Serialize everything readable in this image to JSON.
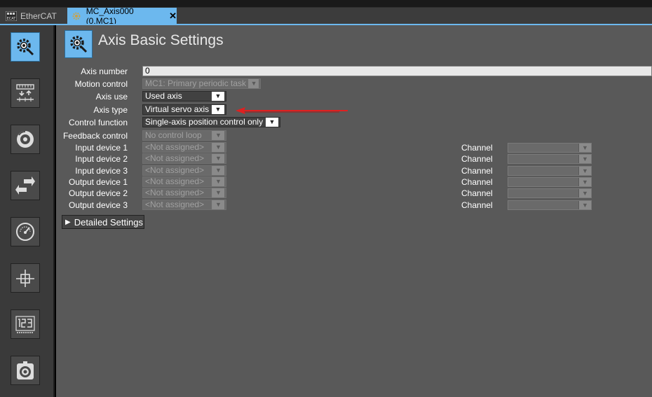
{
  "tabs": [
    {
      "label": "EtherCAT",
      "icon": "ethercat-icon"
    },
    {
      "label": "MC_Axis000 (0,MC1)",
      "icon": "axis-gear-icon",
      "close": "✕"
    }
  ],
  "sidebar": {
    "items": [
      {
        "name": "axis-basic-settings",
        "icon": "gear-settings-icon",
        "active": true
      },
      {
        "name": "unit-conversion",
        "icon": "ruler-arrows-icon"
      },
      {
        "name": "operation-settings",
        "icon": "rotation-icon"
      },
      {
        "name": "other-operation-settings",
        "icon": "double-arrow-icon"
      },
      {
        "name": "limit-settings",
        "icon": "gauge-icon"
      },
      {
        "name": "position-count-settings",
        "icon": "crosshair-icon"
      },
      {
        "name": "servo-drive-settings",
        "icon": "numeric-123-icon"
      },
      {
        "name": "homing-settings",
        "icon": "target-home-icon"
      }
    ]
  },
  "page": {
    "title": "Axis Basic Settings"
  },
  "form": {
    "axis_number": {
      "label": "Axis number",
      "value": "0"
    },
    "motion_control": {
      "label": "Motion control",
      "value": "MC1: Primary periodic task"
    },
    "axis_use": {
      "label": "Axis use",
      "value": "Used axis"
    },
    "axis_type": {
      "label": "Axis type",
      "value": "Virtual servo axis"
    },
    "control_function": {
      "label": "Control function",
      "value": "Single-axis position control only"
    },
    "feedback_control": {
      "label": "Feedback control",
      "value": "No control loop"
    },
    "devices": [
      {
        "label": "Input device 1",
        "value": "<Not assigned>",
        "channel_label": "Channel",
        "channel_value": ""
      },
      {
        "label": "Input device 2",
        "value": "<Not assigned>",
        "channel_label": "Channel",
        "channel_value": ""
      },
      {
        "label": "Input device 3",
        "value": "<Not assigned>",
        "channel_label": "Channel",
        "channel_value": ""
      },
      {
        "label": "Output device 1",
        "value": "<Not assigned>",
        "channel_label": "Channel",
        "channel_value": ""
      },
      {
        "label": "Output device 2",
        "value": "<Not assigned>",
        "channel_label": "Channel",
        "channel_value": ""
      },
      {
        "label": "Output device 3",
        "value": "<Not assigned>",
        "channel_label": "Channel",
        "channel_value": ""
      }
    ]
  },
  "detailed_settings": {
    "label": "Detailed Settings",
    "expander": "▶"
  },
  "dropdown_glyph": "▼",
  "colors": {
    "accent": "#6cb8ee",
    "panel": "#595959",
    "sidebar": "#3a3a3a",
    "annotation": "#e02020"
  }
}
